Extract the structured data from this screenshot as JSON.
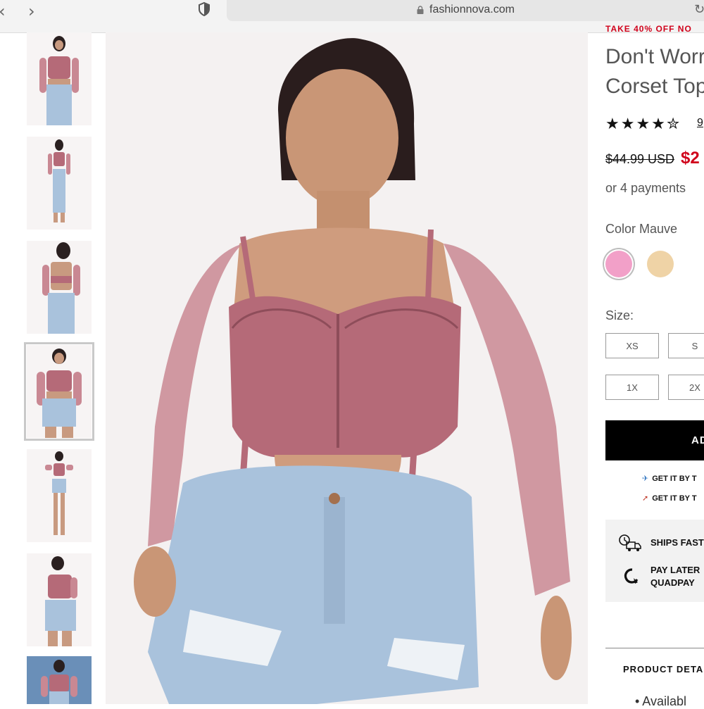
{
  "browser": {
    "back_icon": "‹",
    "forward_icon": "›",
    "url": "fashionnova.com",
    "reload_icon": "↻"
  },
  "product": {
    "promo": "TAKE 40% OFF NO",
    "title_line1": "Don't Worr",
    "title_line2": "Corset Top",
    "rating": 4.5,
    "rating_stars": "★★★★✮",
    "review_count": "9",
    "price_old": "$44.99 USD",
    "price_new": "$2",
    "installments": "or 4 payments",
    "color_label": "Color Mauve",
    "swatches": [
      {
        "name": "Mauve",
        "color": "#f2a0c8"
      },
      {
        "name": "Nude",
        "color": "#efd3a6"
      }
    ],
    "size_label": "Size:",
    "sizes": [
      "XS",
      "S",
      "1X",
      "2X"
    ],
    "add_button": "AD",
    "shipping": [
      {
        "icon": "airplane-icon",
        "glyph": "✈",
        "text": "GET IT BY T"
      },
      {
        "icon": "rocket-icon",
        "glyph": "➚",
        "text": "GET IT BY T"
      }
    ],
    "info": [
      {
        "icon": "truck-clock-icon",
        "text": "SHIPS FAST"
      },
      {
        "icon": "quadpay-icon",
        "text_line1": "PAY LATER",
        "text_line2": "QUADPAY"
      }
    ],
    "details_heading": "PRODUCT DETAI",
    "details_bullet": "• Availabl"
  },
  "colors": {
    "accent_red": "#d0021b",
    "top_mauve": "#b56a78",
    "denim": "#a9c2dc",
    "button_black": "#000000"
  }
}
